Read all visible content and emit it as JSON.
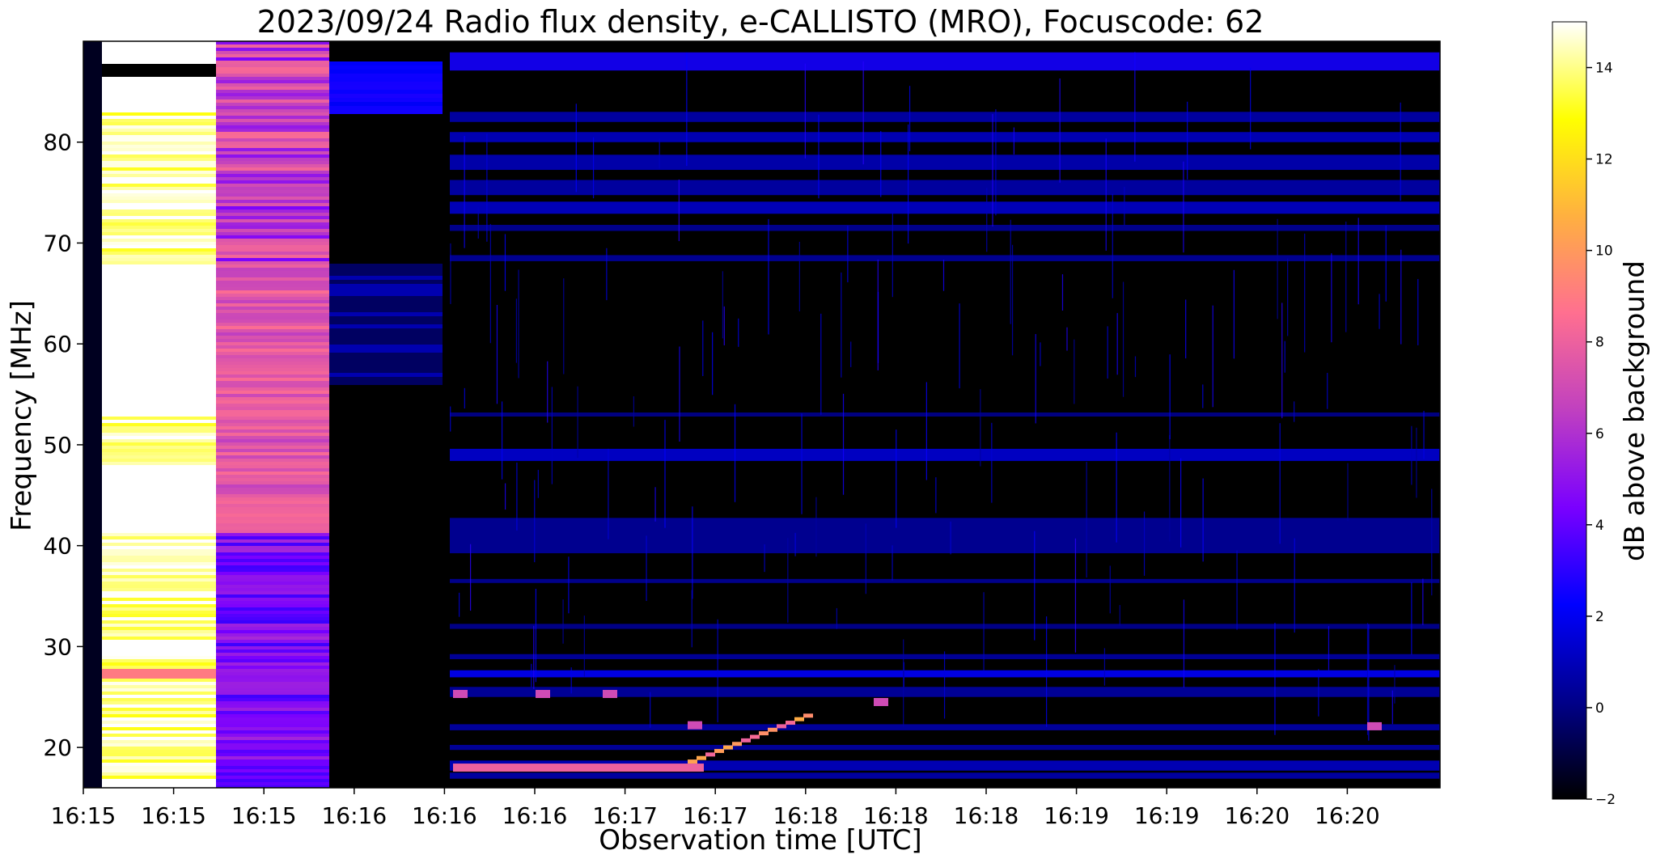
{
  "chart_data": {
    "type": "heatmap",
    "title": "2023/09/24  Radio flux density, e-CALLISTO (MRO), Focuscode: 62",
    "xlabel": "Observation time [UTC]",
    "ylabel": "Frequency [MHz]",
    "x_tick_labels": [
      "16:15",
      "16:15",
      "16:15",
      "16:16",
      "16:16",
      "16:16",
      "16:17",
      "16:17",
      "16:18",
      "16:18",
      "16:18",
      "16:19",
      "16:19",
      "16:20",
      "16:20"
    ],
    "y_ticks": [
      20,
      30,
      40,
      50,
      60,
      70,
      80
    ],
    "ylim": [
      16,
      90
    ],
    "colorbar": {
      "label": "dB above background",
      "ticks": [
        -2,
        0,
        2,
        4,
        6,
        8,
        10,
        12,
        14
      ],
      "range": [
        -2,
        15
      ],
      "colormap": "gnuplot2",
      "stops": [
        "#000000",
        "#00008a",
        "#0000ff",
        "#7a00ff",
        "#c040c0",
        "#ff6f90",
        "#ffb040",
        "#ffff00",
        "#ffffff"
      ]
    },
    "features": [
      {
        "name": "calibration-hot",
        "time_range": [
          "16:15",
          "16:15"
        ],
        "level_db": 14
      },
      {
        "name": "calibration-warm",
        "time_range": [
          "16:15",
          "16:15"
        ],
        "level_db": 7
      },
      {
        "name": "calibration-low",
        "time_range": [
          "16:15",
          "16:16"
        ],
        "level_db": 2
      },
      {
        "name": "calibration-gap",
        "time_range": [
          "16:16",
          "16:16"
        ],
        "level_db": -2
      },
      {
        "name": "drifting-burst",
        "time_range": [
          "16:17",
          "16:18"
        ],
        "freq_range_mhz": [
          18,
          22
        ],
        "level_db": 8
      }
    ]
  }
}
